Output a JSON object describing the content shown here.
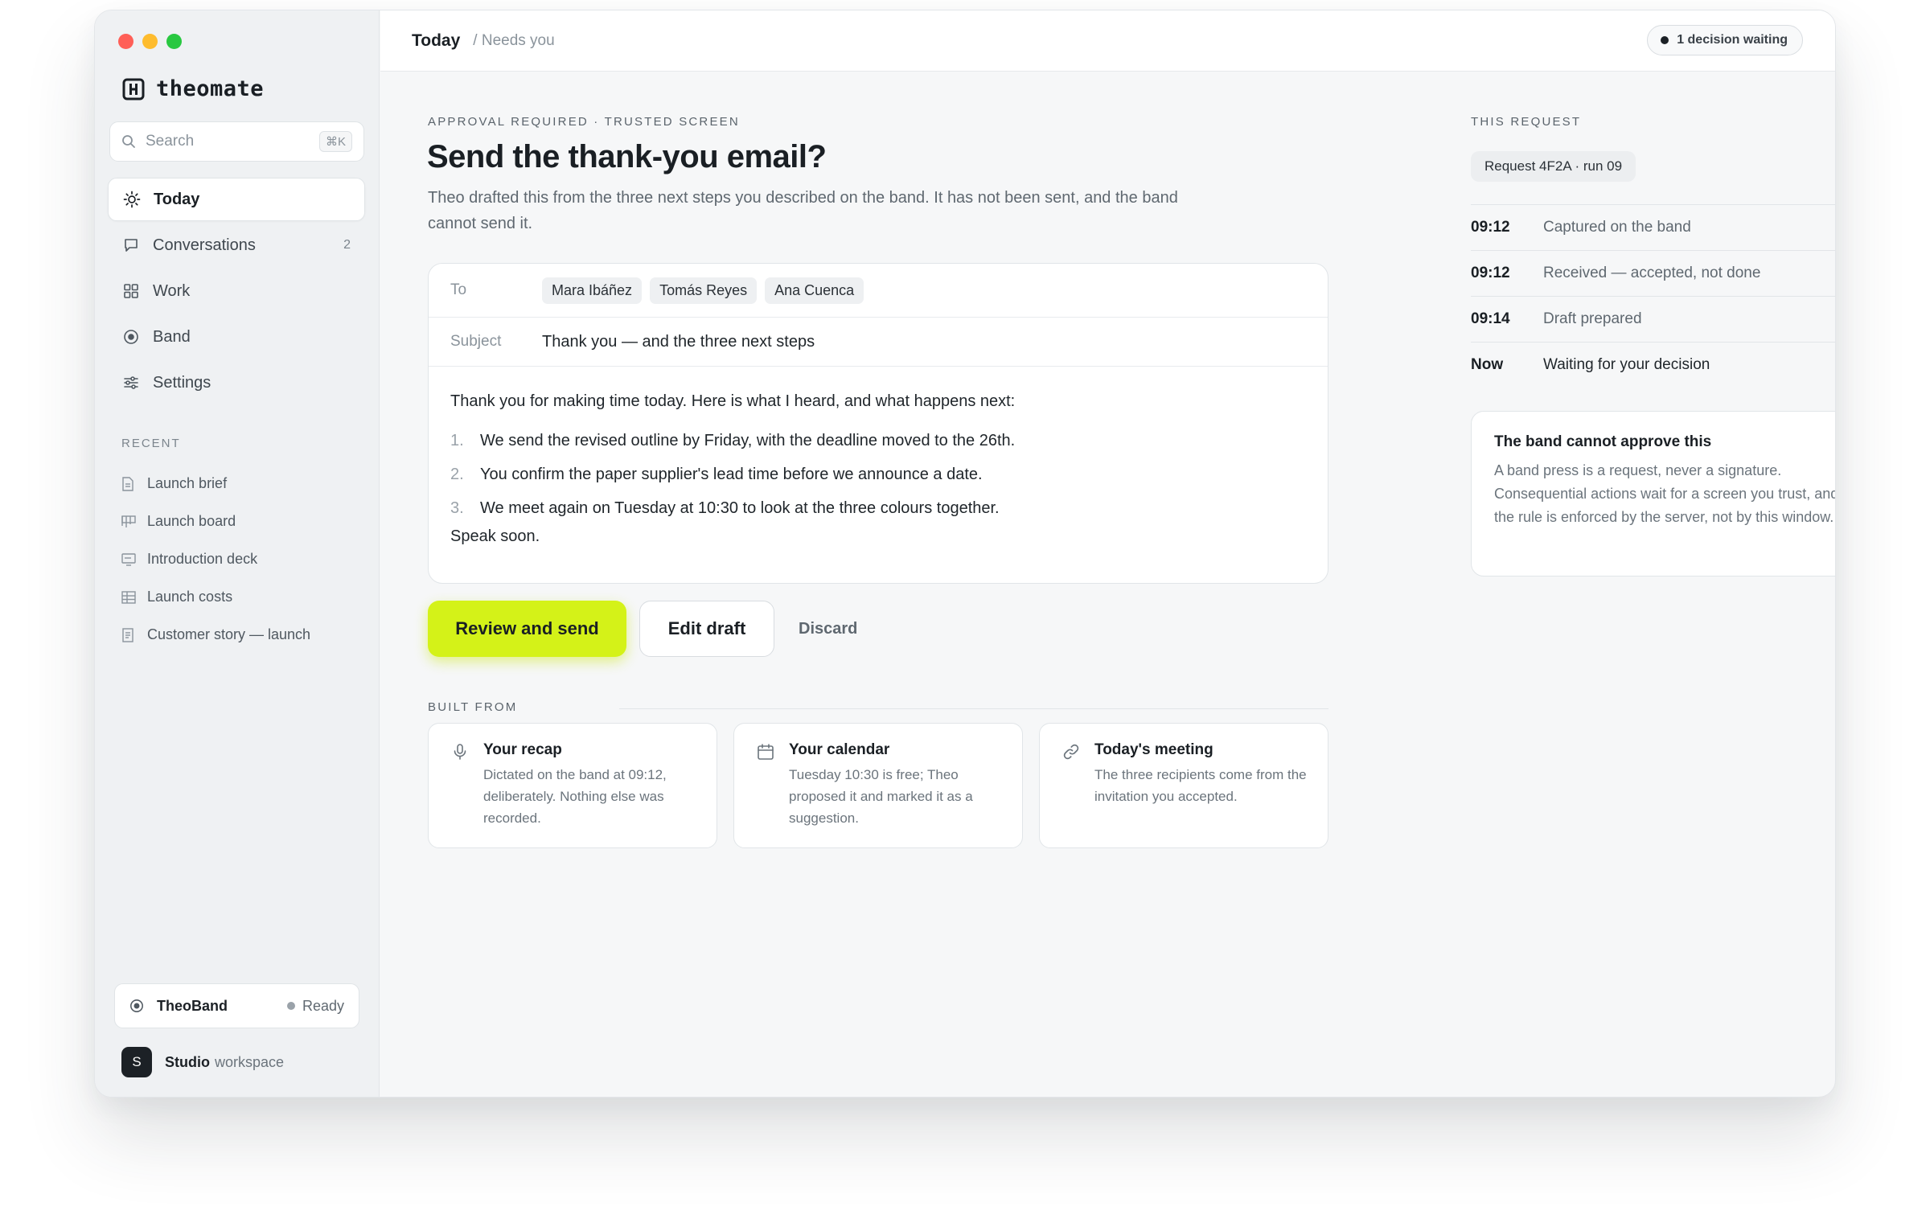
{
  "app": {
    "brand": "theomate",
    "traffic_colors": [
      "#ff5f57",
      "#febc2e",
      "#28c840"
    ],
    "accent": "#d4f218"
  },
  "sidebar": {
    "search_placeholder": "Search",
    "search_shortcut": "⌘K",
    "nav": [
      {
        "label": "Today",
        "icon": "sun-icon",
        "active": true,
        "count": ""
      },
      {
        "label": "Conversations",
        "icon": "chat-icon",
        "count": "2"
      },
      {
        "label": "Work",
        "icon": "grid-icon",
        "count": ""
      },
      {
        "label": "Band",
        "icon": "band-icon",
        "count": ""
      },
      {
        "label": "Settings",
        "icon": "sliders-icon",
        "count": ""
      }
    ],
    "recent_title": "RECENT",
    "recent": [
      {
        "label": "Launch brief",
        "icon": "doc-icon"
      },
      {
        "label": "Launch board",
        "icon": "board-icon"
      },
      {
        "label": "Introduction deck",
        "icon": "slides-icon"
      },
      {
        "label": "Launch costs",
        "icon": "table-icon"
      },
      {
        "label": "Customer story — launch",
        "icon": "page-icon"
      }
    ],
    "device": {
      "name": "TheoBand",
      "status": "Ready"
    },
    "workspace": {
      "initial": "S",
      "name": "Studio",
      "suffix": "workspace"
    }
  },
  "topbar": {
    "crumb_main": "Today",
    "crumb_sub": "/ Needs you",
    "pending": "1 decision waiting"
  },
  "main": {
    "eyebrow": "APPROVAL REQUIRED · TRUSTED SCREEN",
    "title": "Send the thank-you email?",
    "lede": "Theo drafted this from the three next steps you described on the band. It has not been sent, and the band cannot send it.",
    "email": {
      "to_label": "To",
      "recipients": [
        "Mara Ibáñez",
        "Tomás Reyes",
        "Ana Cuenca"
      ],
      "subject_label": "Subject",
      "subject": "Thank you — and the three next steps",
      "intro": "Thank you for making time today. Here is what I heard, and what happens next:",
      "steps": [
        {
          "n": "1.",
          "text": "We send the revised outline by Friday, with the deadline moved to the 26th."
        },
        {
          "n": "2.",
          "text": "You confirm the paper supplier's lead time before we announce a date."
        },
        {
          "n": "3.",
          "text": "We meet again on Tuesday at 10:30 to look at the three colours together."
        }
      ],
      "signoff": "Speak soon."
    },
    "actions": {
      "primary": "Review and send",
      "secondary": "Edit draft",
      "tertiary": "Discard"
    },
    "built_from_title": "BUILT FROM",
    "sources": [
      {
        "icon": "mic-icon",
        "title": "Your recap",
        "text": "Dictated on the band at 09:12, deliberately. Nothing else was recorded."
      },
      {
        "icon": "calendar-icon",
        "title": "Your calendar",
        "text": "Tuesday 10:30 is free; Theo proposed it and marked it as a suggestion."
      },
      {
        "icon": "link-icon",
        "title": "Today's meeting",
        "text": "The three recipients come from the invitation you accepted."
      }
    ]
  },
  "request": {
    "title": "THIS REQUEST",
    "id": "Request 4F2A · run 09",
    "timeline": [
      {
        "time": "09:12",
        "text": "Captured on the band"
      },
      {
        "time": "09:12",
        "text": "Received — accepted, not done"
      },
      {
        "time": "09:14",
        "text": "Draft prepared"
      },
      {
        "time": "Now",
        "text": "Waiting for your decision"
      }
    ],
    "note_title": "The band cannot approve this",
    "note_text": "A band press is a request, never a signature. Consequential actions wait for a screen you trust, and the rule is enforced by the server, not by this window."
  }
}
